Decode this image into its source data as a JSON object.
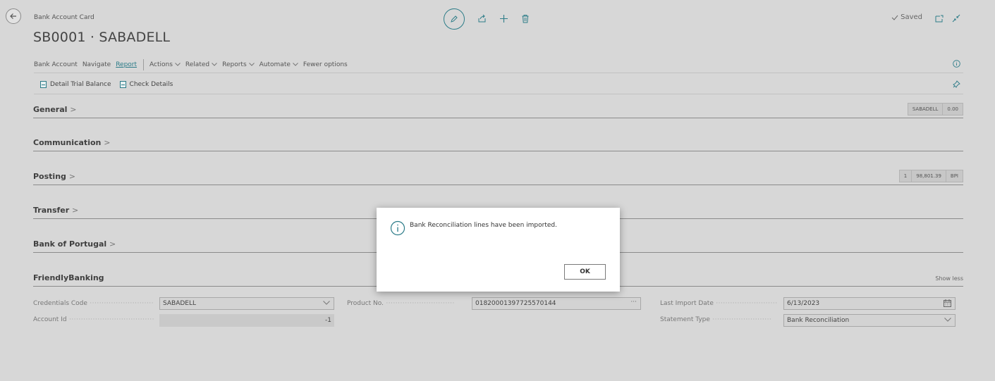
{
  "header": {
    "caption": "Bank Account Card",
    "title": "SB0001 · SABADELL",
    "saved_label": "Saved"
  },
  "action_bar": {
    "items": [
      "Bank Account",
      "Navigate",
      "Report",
      "Actions",
      "Related",
      "Reports",
      "Automate",
      "Fewer options"
    ],
    "active": "Report"
  },
  "promoted_actions": [
    "Detail Trial Balance",
    "Check Details"
  ],
  "sections": {
    "general": {
      "title": "General",
      "boxes": [
        "SABADELL",
        "0.00"
      ]
    },
    "communication": {
      "title": "Communication"
    },
    "posting": {
      "title": "Posting",
      "boxes": [
        "1",
        "98,801.39",
        "BPI"
      ]
    },
    "transfer": {
      "title": "Transfer"
    },
    "bank_of_portugal": {
      "title": "Bank of Portugal"
    },
    "friendly_banking": {
      "title": "FriendlyBanking",
      "toggle": "Show less"
    }
  },
  "fields": {
    "credentials_code": {
      "label": "Credentials Code",
      "value": "SABADELL"
    },
    "account_id": {
      "label": "Account Id",
      "value": "-1"
    },
    "product_no": {
      "label": "Product No.",
      "value": "01820001397725570144"
    },
    "last_import_date": {
      "label": "Last Import Date",
      "value": "6/13/2023"
    },
    "statement_type": {
      "label": "Statement Type",
      "value": "Bank Reconciliation"
    }
  },
  "dialog": {
    "message": "Bank Reconciliation lines have been imported.",
    "ok_label": "OK"
  },
  "colors": {
    "accent": "#2b7b88",
    "background": "#d7d7d7"
  },
  "icons": [
    "back-arrow-icon",
    "edit-icon",
    "share-icon",
    "add-icon",
    "delete-icon",
    "check-icon",
    "open-new-window-icon",
    "collapse-icon",
    "info-icon",
    "report-icon",
    "pin-icon",
    "chevron-down-icon",
    "ellipsis-icon",
    "calendar-icon"
  ]
}
